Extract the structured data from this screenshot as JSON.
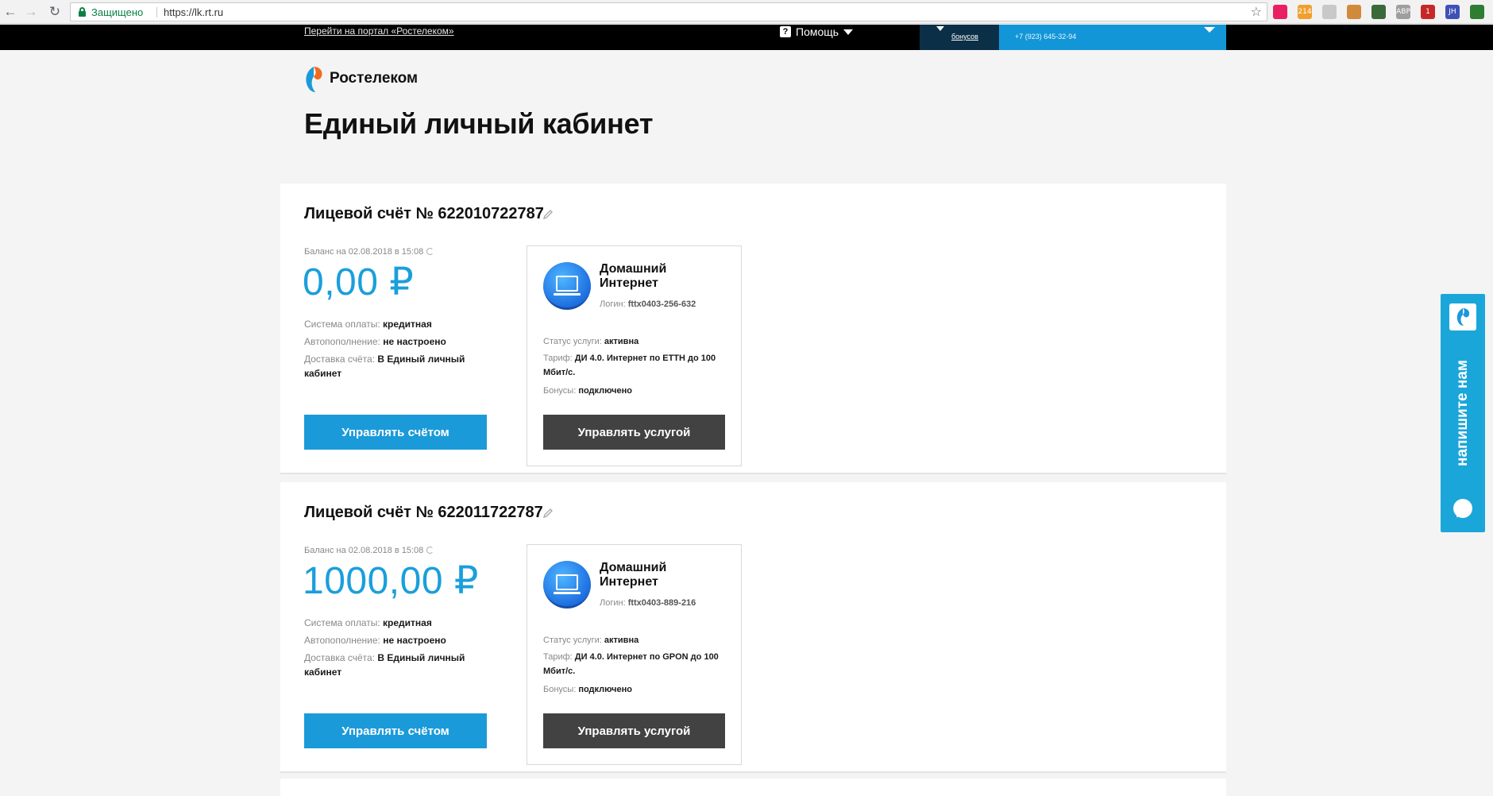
{
  "browser": {
    "secure_label": "Защищено",
    "url": "https://lk.rt.ru",
    "extensions": [
      {
        "name": "extension-pink-icon",
        "color": "#e91e63",
        "text": ""
      },
      {
        "name": "rss-extension-icon",
        "color": "#f0a030",
        "text": "214"
      },
      {
        "name": "extension-envelope-icon",
        "color": "#c8c8c8",
        "text": ""
      },
      {
        "name": "cookie-extension-icon",
        "color": "#d08a3a",
        "text": ""
      },
      {
        "name": "extension-glasses-icon",
        "color": "#3a6a3a",
        "text": ""
      },
      {
        "name": "adblock-extension-icon",
        "color": "#9e9e9e",
        "text": "ABP"
      },
      {
        "name": "extension-badge-icon",
        "color": "#c62828",
        "text": "1"
      },
      {
        "name": "extension-jh-icon",
        "color": "#3f51b5",
        "text": "JH"
      },
      {
        "name": "extension-green-icon",
        "color": "#2e7d32",
        "text": ""
      }
    ]
  },
  "topbar": {
    "portal_link": "Перейти на портал «Ростелеком»",
    "help_label": "Помощь",
    "bonus_label": "бонусов",
    "user_phone": "+7 (923) 645-32-94"
  },
  "brand": "Ростелеком",
  "page_title": "Единый личный кабинет",
  "accounts": [
    {
      "title": "Лицевой счёт № 622010722787",
      "balance_caption": "Баланс на 02.08.2018 в 15:08",
      "balance": "0,00 ₽",
      "payment_label": "Система оплаты:",
      "payment_value": "кредитная",
      "autopay_label": "Автопополнение:",
      "autopay_value": "не настроено",
      "delivery_label": "Доставка счёта:",
      "delivery_value": "В Единый личный кабинет",
      "manage_account": "Управлять счётом",
      "service": {
        "name": "Домашний Интернет",
        "login_label": "Логин:",
        "login_value": "fttx0403-256-632",
        "status_label": "Статус услуги:",
        "status_value": "активна",
        "tariff_label": "Тариф:",
        "tariff_value": "ДИ 4.0. Интернет по ETTH до 100 Мбит/с.",
        "bonus_label": "Бонусы:",
        "bonus_value": "подключено",
        "manage_service": "Управлять услугой"
      }
    },
    {
      "title": "Лицевой счёт № 622011722787",
      "balance_caption": "Баланс на 02.08.2018 в 15:08",
      "balance": "1000,00 ₽",
      "payment_label": "Система оплаты:",
      "payment_value": "кредитная",
      "autopay_label": "Автопополнение:",
      "autopay_value": "не настроено",
      "delivery_label": "Доставка счёта:",
      "delivery_value": "В Единый личный кабинет",
      "manage_account": "Управлять счётом",
      "service": {
        "name": "Домашний Интернет",
        "login_label": "Логин:",
        "login_value": "fttx0403-889-216",
        "status_label": "Статус услуги:",
        "status_value": "активна",
        "tariff_label": "Тариф:",
        "tariff_value": "ДИ 4.0. Интернет по GPON до 100 Мбит/с.",
        "bonus_label": "Бонусы:",
        "bonus_value": "подключено",
        "manage_service": "Управлять услугой"
      }
    }
  ],
  "side_widget": {
    "label": "напишите нам"
  },
  "colors": {
    "brand_blue": "#1b9ad9",
    "balance_blue": "#1a9fdb",
    "service_button": "#424242",
    "widget": "#1ba6d9",
    "secure_green": "#0b8043"
  }
}
